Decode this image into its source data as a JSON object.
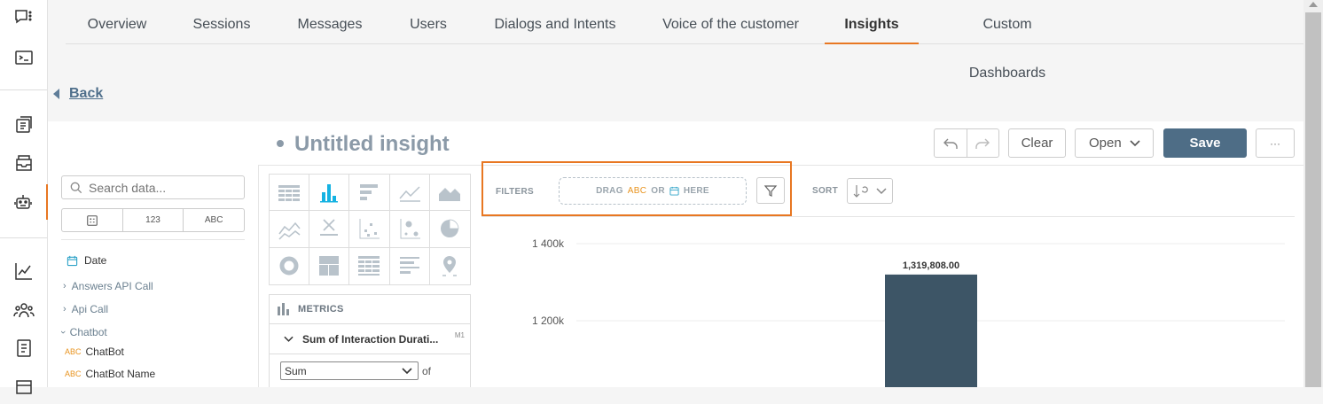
{
  "nav": {
    "tabs": [
      {
        "label": "Overview"
      },
      {
        "label": "Sessions"
      },
      {
        "label": "Messages"
      },
      {
        "label": "Users"
      },
      {
        "label": "Dialogs and Intents"
      },
      {
        "label": "Voice of the customer"
      },
      {
        "label": "Insights",
        "active": true
      },
      {
        "label": "Custom Dashboards"
      }
    ],
    "accent_color": "#e87722"
  },
  "back_label": "Back",
  "insight": {
    "title": "Untitled insight"
  },
  "toolbar": {
    "clear_label": "Clear",
    "open_label": "Open",
    "save_label": "Save",
    "more_label": "···",
    "save_color": "#4e6d86"
  },
  "catalog": {
    "search_placeholder": "Search data...",
    "type_filters": [
      "",
      "123",
      "ABC"
    ],
    "tree": {
      "date": "Date",
      "groups": [
        {
          "label": "Answers API Call",
          "expanded": false
        },
        {
          "label": "Api Call",
          "expanded": false
        },
        {
          "label": "Chatbot",
          "expanded": true
        }
      ],
      "items": [
        {
          "badge": "ABC",
          "label": "ChatBot"
        },
        {
          "badge": "ABC",
          "label": "ChatBot Name"
        }
      ]
    }
  },
  "chart_types": {
    "selected": "column-chart",
    "items": [
      "table-icon",
      "column-chart-icon",
      "bar-chart-icon",
      "line-chart-icon",
      "area-chart-icon",
      "combo-chart-icon",
      "headline-icon",
      "scatter-plot-icon",
      "bubble-chart-icon",
      "pie-chart-icon",
      "donut-chart-icon",
      "treemap-icon",
      "heatmap-icon",
      "bullet-chart-icon",
      "geo-pushpin-icon"
    ]
  },
  "metrics": {
    "header": "METRICS",
    "item_title": "Sum of Interaction Durati...",
    "item_tag": "M1",
    "aggregation": "Sum",
    "of_label": "of"
  },
  "filters": {
    "label": "FILTERS",
    "drop_text_1": "DRAG",
    "drop_abc": "ABC",
    "drop_text_2": "OR",
    "drop_text_3": "HERE"
  },
  "sort": {
    "label": "SORT"
  },
  "chart_data": {
    "type": "bar",
    "categories": [
      ""
    ],
    "values": [
      1319808.0
    ],
    "data_labels": [
      "1,319,808.00"
    ],
    "y_ticks": [
      {
        "value": 1200000,
        "label": "1 200k"
      },
      {
        "value": 1400000,
        "label": "1 400k"
      }
    ],
    "ylim": [
      1000000,
      1450000
    ],
    "bar_color": "#3d5566",
    "grid": true
  }
}
